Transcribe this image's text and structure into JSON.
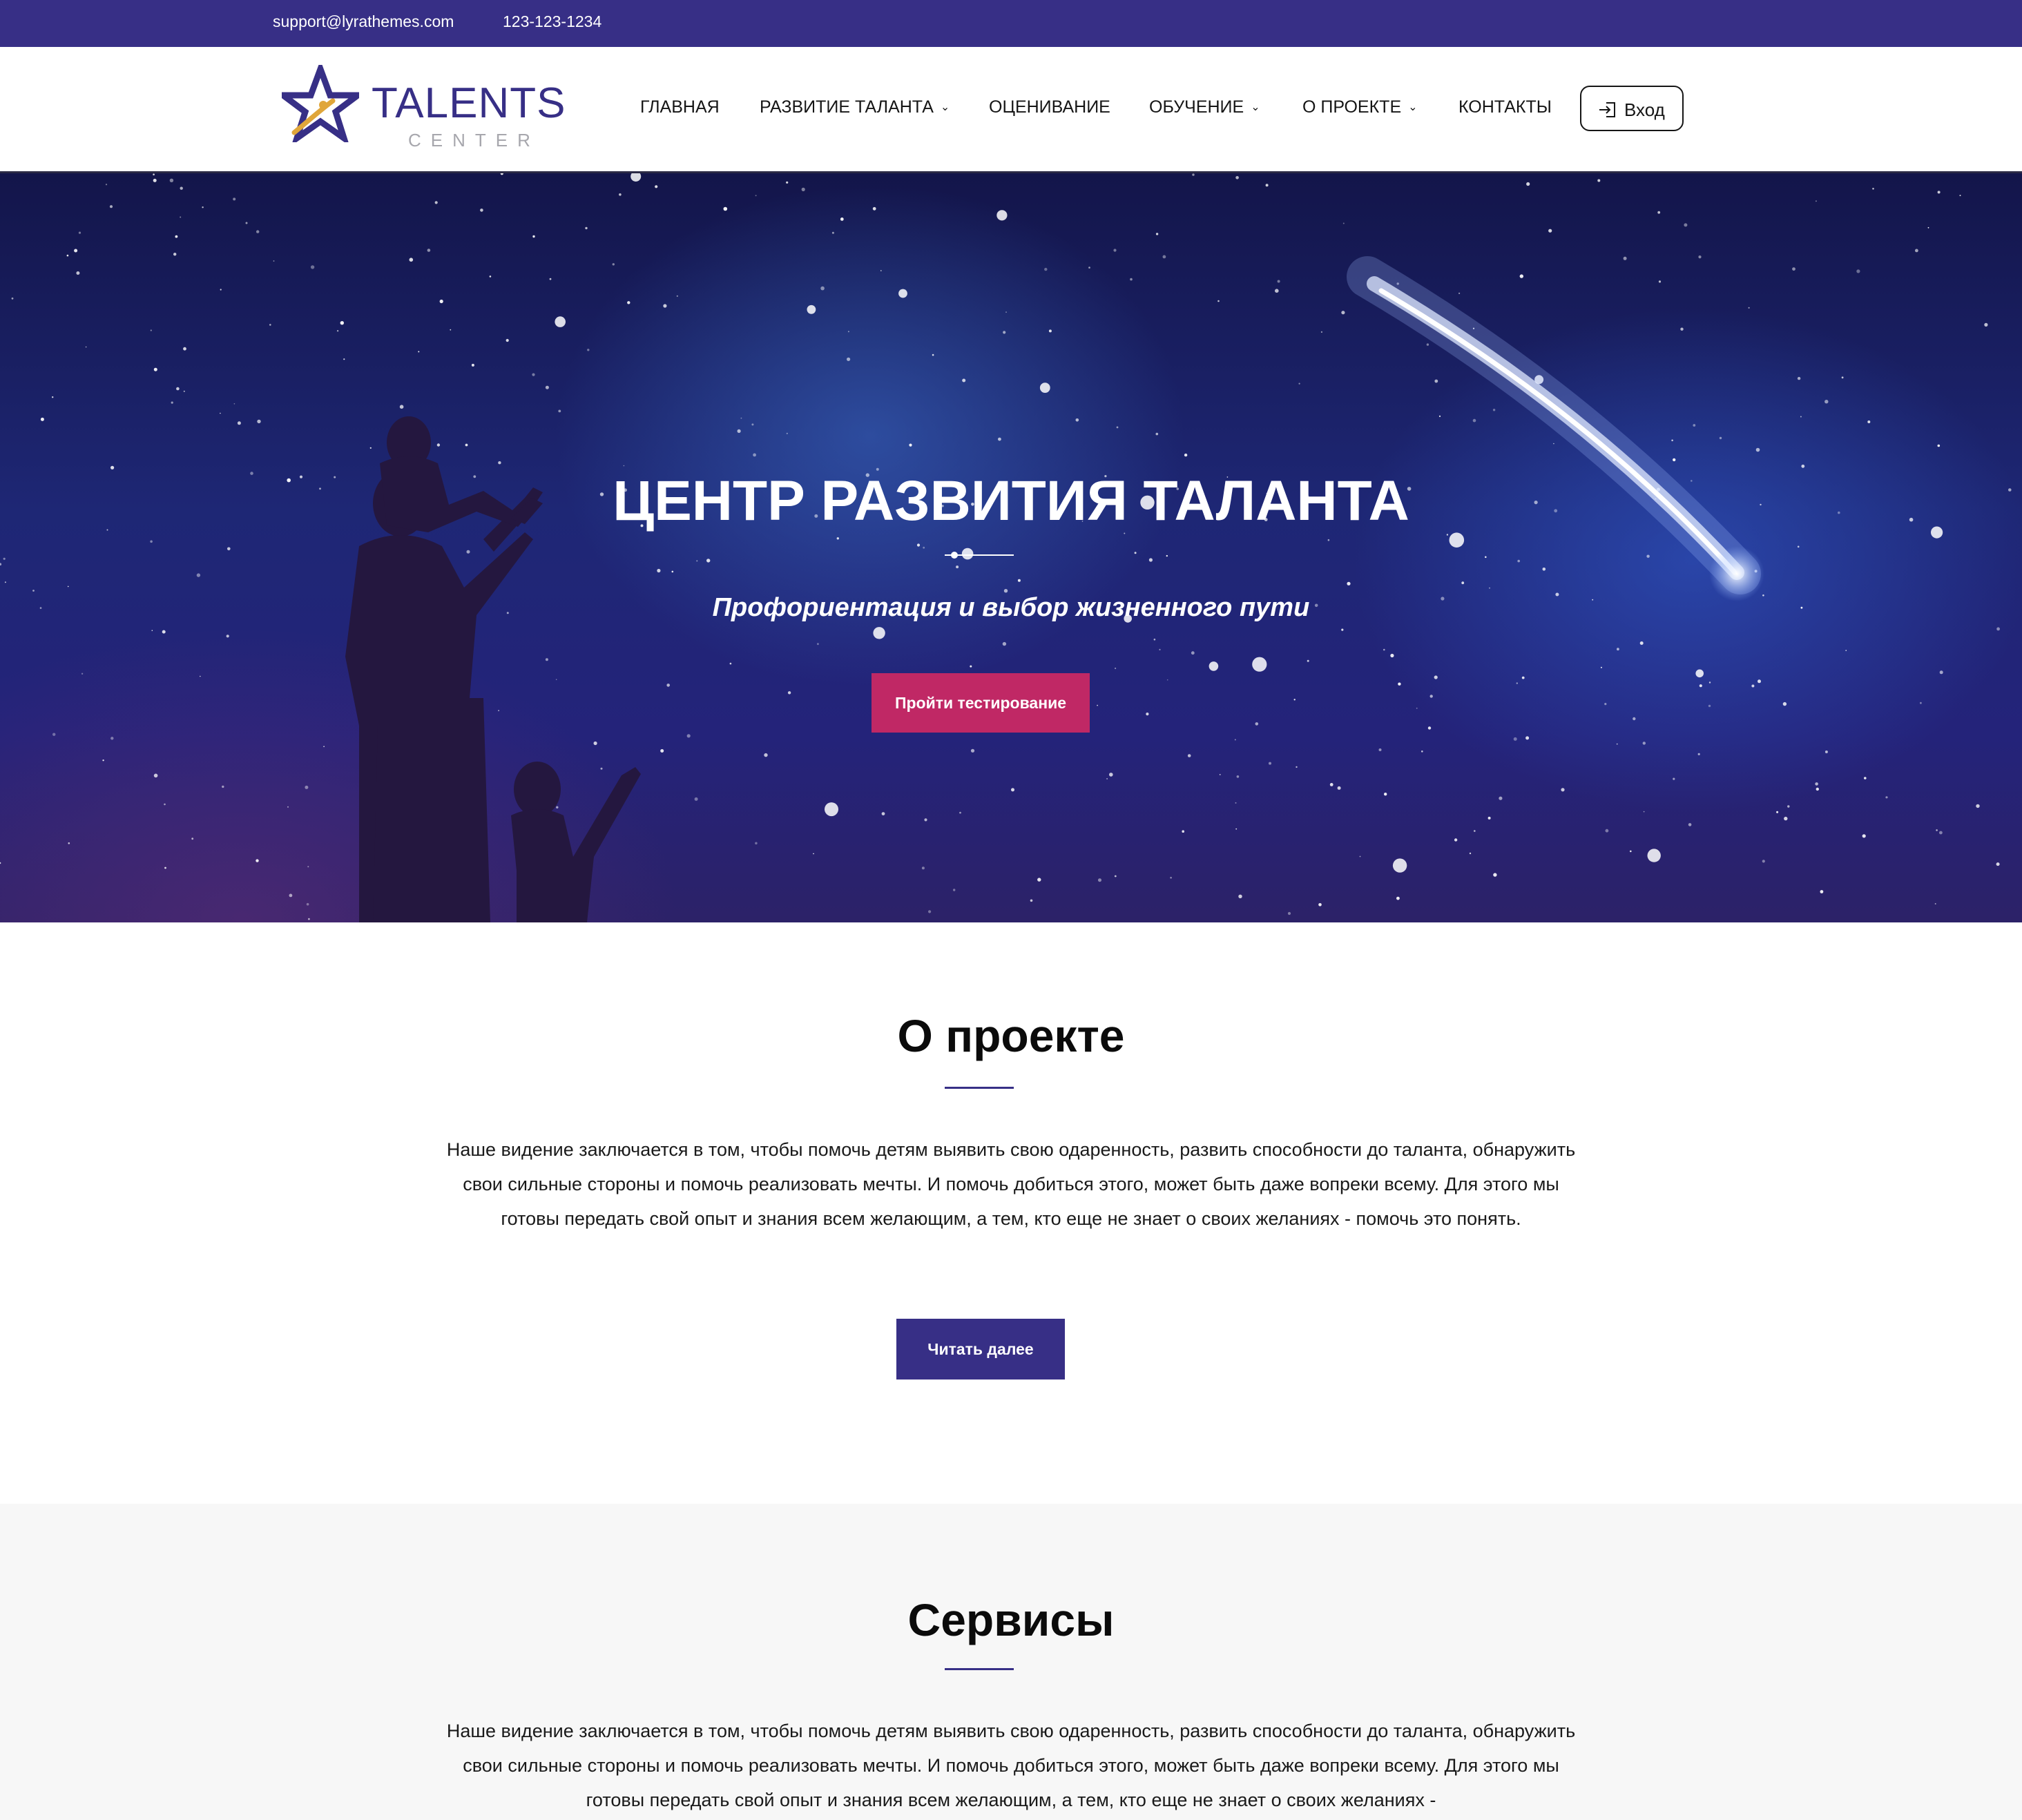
{
  "topbar": {
    "email": "support@lyrathemes.com",
    "phone": "123-123-1234"
  },
  "logo": {
    "word": "TALENTS",
    "sub": "CENTER"
  },
  "nav": {
    "items": [
      {
        "label": "Главная",
        "dropdown": false
      },
      {
        "label": "Развитие таланта",
        "dropdown": true
      },
      {
        "label": "Оценивание",
        "dropdown": false
      },
      {
        "label": "Обучение",
        "dropdown": true
      },
      {
        "label": "О проекте",
        "dropdown": true
      },
      {
        "label": "Контакты",
        "dropdown": false
      }
    ],
    "login_label": "Вход"
  },
  "hero": {
    "title": "ЦЕНТР РАЗВИТИЯ ТАЛАНТА",
    "subtitle": "Профориентация и выбор жизненного пути",
    "button_label": "Пройти тестирование"
  },
  "about": {
    "title": "О проекте",
    "text": "Наше видение заключается в том, чтобы помочь детям выявить свою одаренность, развить способности до таланта, обнаружить свои сильные стороны и помочь реализовать мечты. И помочь добиться этого, может быть даже вопреки всему. Для этого мы готовы передать свой опыт и знания всем желающим, а тем, кто еще не знает о своих желаниях - помочь это понять.",
    "button_label": "Читать далее"
  },
  "services": {
    "title": "Сервисы",
    "text": "Наше видение заключается в том, чтобы помочь детям выявить свою одаренность, развить способности до таланта, обнаружить свои сильные стороны и помочь реализовать мечты. И помочь добиться этого, может быть даже вопреки всему. Для этого мы готовы передать свой опыт и знания всем желающим, а тем, кто еще не знает о своих желаниях -"
  },
  "colors": {
    "brand": "#372f86",
    "accent": "#c02865",
    "logo_gold": "#e0a63a"
  },
  "icons": {
    "logo": "star-icon",
    "login": "sign-in-icon",
    "dropdown": "chevron-down-icon"
  }
}
